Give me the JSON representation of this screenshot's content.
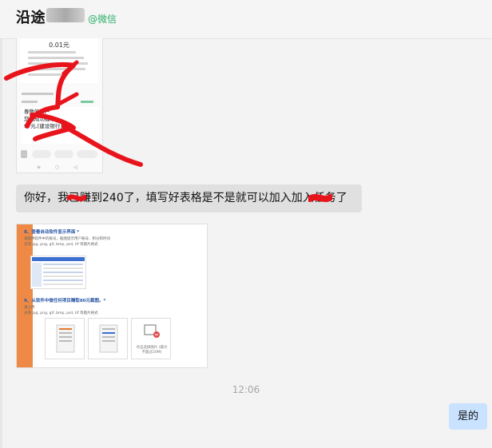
{
  "header": {
    "title": "沿途",
    "badge": "@微信"
  },
  "messages": {
    "image_1": {
      "amount": "0.01元",
      "notice_lines": [
        "尊敬的客户",
        "您已成功提取",
        "97元,[建设银行]"
      ]
    },
    "text_1": "你好，我已赚到240了，填写好表格是不是就可以加入加入任务了",
    "image_2": {
      "question_8": "8、查看自动软件显示界面 *",
      "question_8_hint": "请提供软件中的账号，截图提示用户账号、积分和时间",
      "question_8_types": "支持 jpg, png, gif, bmp, psd, tif 等图片格式",
      "question_9": "9、从软件中做任何项目赚取80元截图。*",
      "question_9_sub": "请上传",
      "question_9_types": "支持 jpg, png, gif, bmp, psd, tif 等图片格式",
      "upload_label": "点击选择图片 (最大不超过20M)"
    },
    "timestamp": "12:06",
    "reply": "是的"
  },
  "colors": {
    "background": "#f3f3f3",
    "bubble_other": "#e0e0e0",
    "bubble_self": "#c9e2ff",
    "wechat_green": "#2aae67",
    "scribble_red": "#e8141c",
    "form_stripe": "#ee8a45"
  }
}
